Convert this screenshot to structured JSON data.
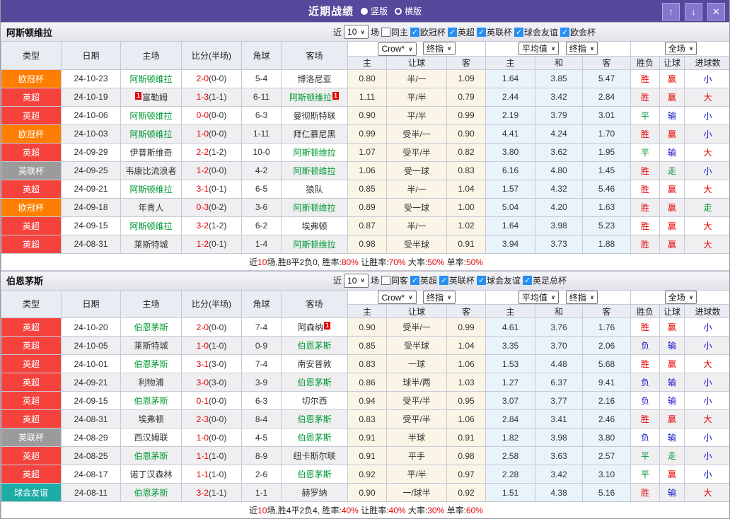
{
  "titlebar": {
    "title": "近期战绩",
    "radios": [
      {
        "label": "竖版",
        "selected": true
      },
      {
        "label": "横版",
        "selected": false
      }
    ],
    "buttons": {
      "up": "↑",
      "down": "↓",
      "close": "✕"
    }
  },
  "league_colors": {
    "欧冠杯": "#ff7e00",
    "英超": "#f5423d",
    "英联杯": "#9b9b9b",
    "球会友谊": "#1cada5"
  },
  "result_colors": {
    "r": "#e60000",
    "g": "#009933",
    "b": "#1515cc"
  },
  "table_header": {
    "cols": [
      "类型",
      "日期",
      "主场",
      "比分(半场)",
      "角球",
      "客场"
    ],
    "selects": {
      "crow": "Crow*",
      "crow_idx": "终指",
      "avg": "平均值",
      "avg_idx": "终指",
      "full": "全场"
    },
    "sub": [
      "主",
      "让球",
      "客",
      "主",
      "和",
      "客",
      "胜负",
      "让球",
      "进球数"
    ]
  },
  "sections": [
    {
      "team": "阿斯顿维拉",
      "filter": {
        "near": "近",
        "count": "10",
        "games": "场",
        "same_label": "同主",
        "same_checked": false,
        "leagues": [
          "欧冠杯",
          "英超",
          "英联杯",
          "球会友谊",
          "欧会杯"
        ]
      },
      "rows": [
        {
          "league": "欧冠杯",
          "date": "24-10-23",
          "home": {
            "name": "阿斯顿维拉",
            "self": true
          },
          "score_ft": "2-0",
          "score_ht": "(0-0)",
          "corners": "5-4",
          "away": {
            "name": "博洛尼亚"
          },
          "odds": [
            "0.80",
            "半/一",
            "1.09",
            "1.64",
            "3.85",
            "5.47"
          ],
          "results": [
            [
              "胜",
              "r"
            ],
            [
              "赢",
              "r"
            ],
            [
              "小",
              "b"
            ]
          ]
        },
        {
          "league": "英超",
          "date": "24-10-19",
          "home": {
            "name": "富勒姆",
            "badge": "1",
            "badge_pos": "pre"
          },
          "score_ft": "1-3",
          "score_ht": "(1-1)",
          "corners": "6-11",
          "away": {
            "name": "阿斯顿维拉",
            "self": true,
            "badge": "1",
            "badge_pos": "post"
          },
          "odds": [
            "1.11",
            "平/半",
            "0.79",
            "2.44",
            "3.42",
            "2.84"
          ],
          "results": [
            [
              "胜",
              "r"
            ],
            [
              "赢",
              "r"
            ],
            [
              "大",
              "r"
            ]
          ]
        },
        {
          "league": "英超",
          "date": "24-10-06",
          "home": {
            "name": "阿斯顿维拉",
            "self": true
          },
          "score_ft": "0-0",
          "score_ht": "(0-0)",
          "corners": "6-3",
          "away": {
            "name": "曼彻斯特联"
          },
          "odds": [
            "0.90",
            "平/半",
            "0.99",
            "2.19",
            "3.79",
            "3.01"
          ],
          "results": [
            [
              "平",
              "g"
            ],
            [
              "输",
              "b"
            ],
            [
              "小",
              "b"
            ]
          ]
        },
        {
          "league": "欧冠杯",
          "date": "24-10-03",
          "home": {
            "name": "阿斯顿维拉",
            "self": true
          },
          "score_ft": "1-0",
          "score_ht": "(0-0)",
          "corners": "1-11",
          "away": {
            "name": "拜仁慕尼黑"
          },
          "odds": [
            "0.99",
            "受半/一",
            "0.90",
            "4.41",
            "4.24",
            "1.70"
          ],
          "results": [
            [
              "胜",
              "r"
            ],
            [
              "赢",
              "r"
            ],
            [
              "小",
              "b"
            ]
          ]
        },
        {
          "league": "英超",
          "date": "24-09-29",
          "home": {
            "name": "伊普斯维奇"
          },
          "score_ft": "2-2",
          "score_ht": "(1-2)",
          "corners": "10-0",
          "away": {
            "name": "阿斯顿维拉",
            "self": true
          },
          "odds": [
            "1.07",
            "受平/半",
            "0.82",
            "3.80",
            "3.62",
            "1.95"
          ],
          "results": [
            [
              "平",
              "g"
            ],
            [
              "输",
              "b"
            ],
            [
              "大",
              "r"
            ]
          ]
        },
        {
          "league": "英联杯",
          "date": "24-09-25",
          "home": {
            "name": "韦康比流浪者"
          },
          "score_ft": "1-2",
          "score_ht": "(0-0)",
          "corners": "4-2",
          "away": {
            "name": "阿斯顿维拉",
            "self": true
          },
          "odds": [
            "1.06",
            "受一球",
            "0.83",
            "6.16",
            "4.80",
            "1.45"
          ],
          "results": [
            [
              "胜",
              "r"
            ],
            [
              "走",
              "g"
            ],
            [
              "小",
              "b"
            ]
          ]
        },
        {
          "league": "英超",
          "date": "24-09-21",
          "home": {
            "name": "阿斯顿维拉",
            "self": true
          },
          "score_ft": "3-1",
          "score_ht": "(0-1)",
          "corners": "6-5",
          "away": {
            "name": "狼队"
          },
          "odds": [
            "0.85",
            "半/一",
            "1.04",
            "1.57",
            "4.32",
            "5.46"
          ],
          "results": [
            [
              "胜",
              "r"
            ],
            [
              "赢",
              "r"
            ],
            [
              "大",
              "r"
            ]
          ]
        },
        {
          "league": "欧冠杯",
          "date": "24-09-18",
          "home": {
            "name": "年青人"
          },
          "score_ft": "0-3",
          "score_ht": "(0-2)",
          "corners": "3-6",
          "away": {
            "name": "阿斯顿维拉",
            "self": true
          },
          "odds": [
            "0.89",
            "受一球",
            "1.00",
            "5.04",
            "4.20",
            "1.63"
          ],
          "results": [
            [
              "胜",
              "r"
            ],
            [
              "赢",
              "r"
            ],
            [
              "走",
              "g"
            ]
          ]
        },
        {
          "league": "英超",
          "date": "24-09-15",
          "home": {
            "name": "阿斯顿维拉",
            "self": true
          },
          "score_ft": "3-2",
          "score_ht": "(1-2)",
          "corners": "6-2",
          "away": {
            "name": "埃弗顿"
          },
          "odds": [
            "0.87",
            "半/一",
            "1.02",
            "1.64",
            "3.98",
            "5.23"
          ],
          "results": [
            [
              "胜",
              "r"
            ],
            [
              "赢",
              "r"
            ],
            [
              "大",
              "r"
            ]
          ]
        },
        {
          "league": "英超",
          "date": "24-08-31",
          "home": {
            "name": "莱斯特城"
          },
          "score_ft": "1-2",
          "score_ht": "(0-1)",
          "corners": "1-4",
          "away": {
            "name": "阿斯顿维拉",
            "self": true
          },
          "odds": [
            "0.98",
            "受半球",
            "0.91",
            "3.94",
            "3.73",
            "1.88"
          ],
          "results": [
            [
              "胜",
              "r"
            ],
            [
              "赢",
              "r"
            ],
            [
              "大",
              "r"
            ]
          ]
        }
      ],
      "summary": [
        {
          "t": "近",
          "red": false
        },
        {
          "t": "10",
          "red": true
        },
        {
          "t": "场,胜8平2负0, 胜率:",
          "red": false
        },
        {
          "t": "80%",
          "red": true
        },
        {
          "t": " 让胜率:",
          "red": false
        },
        {
          "t": "70%",
          "red": true
        },
        {
          "t": " 大率:",
          "red": false
        },
        {
          "t": "50%",
          "red": true
        },
        {
          "t": " 单率:",
          "red": false
        },
        {
          "t": "50%",
          "red": true
        }
      ]
    },
    {
      "team": "伯恩茅斯",
      "filter": {
        "near": "近",
        "count": "10",
        "games": "场",
        "same_label": "同客",
        "same_checked": false,
        "leagues": [
          "英超",
          "英联杯",
          "球会友谊",
          "英足总杯"
        ]
      },
      "rows": [
        {
          "league": "英超",
          "date": "24-10-20",
          "home": {
            "name": "伯恩茅斯",
            "self": true
          },
          "score_ft": "2-0",
          "score_ht": "(0-0)",
          "corners": "7-4",
          "away": {
            "name": "阿森纳",
            "badge": "1",
            "badge_pos": "post"
          },
          "odds": [
            "0.90",
            "受半/一",
            "0.99",
            "4.61",
            "3.76",
            "1.76"
          ],
          "results": [
            [
              "胜",
              "r"
            ],
            [
              "赢",
              "r"
            ],
            [
              "小",
              "b"
            ]
          ]
        },
        {
          "league": "英超",
          "date": "24-10-05",
          "home": {
            "name": "莱斯特城"
          },
          "score_ft": "1-0",
          "score_ht": "(1-0)",
          "corners": "0-9",
          "away": {
            "name": "伯恩茅斯",
            "self": true
          },
          "odds": [
            "0.85",
            "受半球",
            "1.04",
            "3.35",
            "3.70",
            "2.06"
          ],
          "results": [
            [
              "负",
              "b"
            ],
            [
              "输",
              "b"
            ],
            [
              "小",
              "b"
            ]
          ]
        },
        {
          "league": "英超",
          "date": "24-10-01",
          "home": {
            "name": "伯恩茅斯",
            "self": true
          },
          "score_ft": "3-1",
          "score_ht": "(3-0)",
          "corners": "7-4",
          "away": {
            "name": "南安普敦"
          },
          "odds": [
            "0.83",
            "一球",
            "1.06",
            "1.53",
            "4.48",
            "5.68"
          ],
          "results": [
            [
              "胜",
              "r"
            ],
            [
              "赢",
              "r"
            ],
            [
              "大",
              "r"
            ]
          ]
        },
        {
          "league": "英超",
          "date": "24-09-21",
          "home": {
            "name": "利物浦"
          },
          "score_ft": "3-0",
          "score_ht": "(3-0)",
          "corners": "3-9",
          "away": {
            "name": "伯恩茅斯",
            "self": true
          },
          "odds": [
            "0.86",
            "球半/两",
            "1.03",
            "1.27",
            "6.37",
            "9.41"
          ],
          "results": [
            [
              "负",
              "b"
            ],
            [
              "输",
              "b"
            ],
            [
              "小",
              "b"
            ]
          ]
        },
        {
          "league": "英超",
          "date": "24-09-15",
          "home": {
            "name": "伯恩茅斯",
            "self": true
          },
          "score_ft": "0-1",
          "score_ht": "(0-0)",
          "corners": "6-3",
          "away": {
            "name": "切尔西"
          },
          "odds": [
            "0.94",
            "受平/半",
            "0.95",
            "3.07",
            "3.77",
            "2.16"
          ],
          "results": [
            [
              "负",
              "b"
            ],
            [
              "输",
              "b"
            ],
            [
              "小",
              "b"
            ]
          ]
        },
        {
          "league": "英超",
          "date": "24-08-31",
          "home": {
            "name": "埃弗顿"
          },
          "score_ft": "2-3",
          "score_ht": "(0-0)",
          "corners": "8-4",
          "away": {
            "name": "伯恩茅斯",
            "self": true
          },
          "odds": [
            "0.83",
            "受平/半",
            "1.06",
            "2.84",
            "3.41",
            "2.46"
          ],
          "results": [
            [
              "胜",
              "r"
            ],
            [
              "赢",
              "r"
            ],
            [
              "大",
              "r"
            ]
          ]
        },
        {
          "league": "英联杯",
          "date": "24-08-29",
          "home": {
            "name": "西汉姆联"
          },
          "score_ft": "1-0",
          "score_ht": "(0-0)",
          "corners": "4-5",
          "away": {
            "name": "伯恩茅斯",
            "self": true
          },
          "odds": [
            "0.91",
            "半球",
            "0.91",
            "1.82",
            "3.98",
            "3.80"
          ],
          "results": [
            [
              "负",
              "b"
            ],
            [
              "输",
              "b"
            ],
            [
              "小",
              "b"
            ]
          ]
        },
        {
          "league": "英超",
          "date": "24-08-25",
          "home": {
            "name": "伯恩茅斯",
            "self": true
          },
          "score_ft": "1-1",
          "score_ht": "(1-0)",
          "corners": "8-9",
          "away": {
            "name": "纽卡斯尔联"
          },
          "odds": [
            "0.91",
            "平手",
            "0.98",
            "2.58",
            "3.63",
            "2.57"
          ],
          "results": [
            [
              "平",
              "g"
            ],
            [
              "走",
              "g"
            ],
            [
              "小",
              "b"
            ]
          ]
        },
        {
          "league": "英超",
          "date": "24-08-17",
          "home": {
            "name": "诺丁汉森林"
          },
          "score_ft": "1-1",
          "score_ht": "(1-0)",
          "corners": "2-6",
          "away": {
            "name": "伯恩茅斯",
            "self": true
          },
          "odds": [
            "0.92",
            "平/半",
            "0.97",
            "2.28",
            "3.42",
            "3.10"
          ],
          "results": [
            [
              "平",
              "g"
            ],
            [
              "赢",
              "r"
            ],
            [
              "小",
              "b"
            ]
          ]
        },
        {
          "league": "球会友谊",
          "date": "24-08-11",
          "home": {
            "name": "伯恩茅斯",
            "self": true
          },
          "score_ft": "3-2",
          "score_ht": "(1-1)",
          "corners": "1-1",
          "away": {
            "name": "赫罗纳"
          },
          "odds": [
            "0.90",
            "一/球半",
            "0.92",
            "1.51",
            "4.38",
            "5.16"
          ],
          "results": [
            [
              "胜",
              "r"
            ],
            [
              "输",
              "b"
            ],
            [
              "大",
              "r"
            ]
          ]
        }
      ],
      "summary": [
        {
          "t": "近",
          "red": false
        },
        {
          "t": "10",
          "red": true
        },
        {
          "t": "场,胜4平2负4, 胜率:",
          "red": false
        },
        {
          "t": "40%",
          "red": true
        },
        {
          "t": " 让胜率:",
          "red": false
        },
        {
          "t": "40%",
          "red": true
        },
        {
          "t": " 大率:",
          "red": false
        },
        {
          "t": "30%",
          "red": true
        },
        {
          "t": " 单率:",
          "red": false
        },
        {
          "t": "60%",
          "red": true
        }
      ]
    }
  ]
}
